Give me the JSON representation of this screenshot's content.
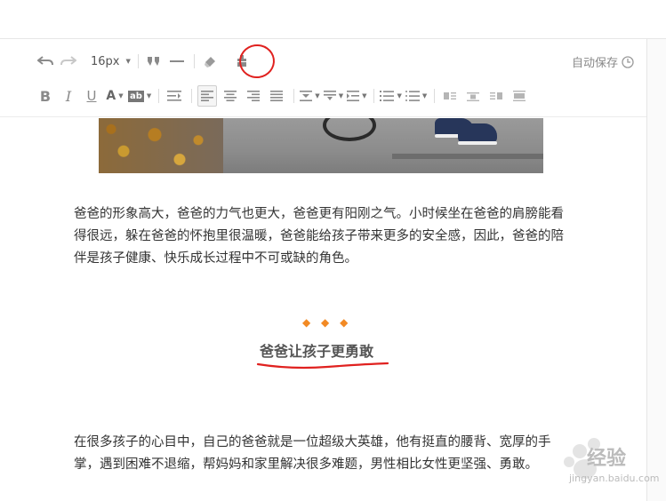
{
  "toolbar": {
    "font_size": "16px",
    "icons_row1": [
      "undo-icon",
      "redo-icon",
      "font-size-select",
      "quote-icon",
      "horizontal-rule-icon",
      "clear-format-icon",
      "format-painter-icon"
    ],
    "icons_row2": [
      "bold-icon",
      "italic-icon",
      "underline-icon",
      "font-color-icon",
      "background-color-icon",
      "indent-icon",
      "align-left-icon",
      "align-center-icon",
      "align-right-icon",
      "align-justify-icon",
      "line-height-icon",
      "paragraph-spacing-icon",
      "indent-select-icon",
      "ordered-list-icon",
      "unordered-list-icon",
      "image-left-icon",
      "image-center-icon",
      "image-right-icon",
      "image-full-icon"
    ],
    "letters": {
      "bold": "B",
      "italic": "I",
      "underline": "U",
      "font_color": "A",
      "background": "ab"
    }
  },
  "autosave": {
    "label": "自动保存"
  },
  "article": {
    "paragraph1": "爸爸的形象高大，爸爸的力气也更大，爸爸更有阳刚之气。小时候坐在爸爸的肩膀能看得很远，躲在爸爸的怀抱里很温暖，爸爸能给孩子带来更多的安全感，因此，爸爸的陪伴是孩子健康、快乐成长过程中不可或缺的角色。",
    "dots": "◆ ◆ ◆",
    "subtitle": "爸爸让孩子更勇敢",
    "paragraph2": "在很多孩子的心目中，自己的爸爸就是一位超级大英雄，他有挺直的腰背、宽厚的手掌，遇到困难不退缩，帮妈妈和家里解决很多难题，男性相比女性更坚强、勇敢。"
  },
  "watermark": {
    "text": "经验",
    "url": "jingyan.baidu.com"
  },
  "colors": {
    "annotation_red": "#e0211f",
    "accent_orange": "#f28a24",
    "icon_gray": "#8a8a8a"
  }
}
